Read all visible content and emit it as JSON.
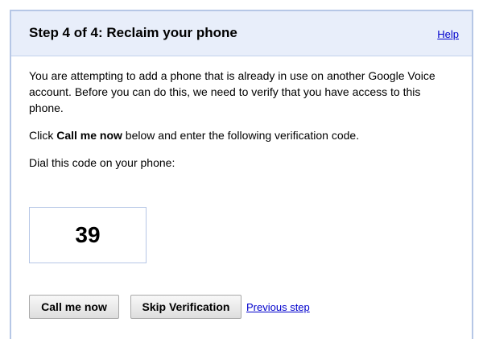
{
  "dialog": {
    "title": "Step 4 of 4: Reclaim your phone",
    "help_link": "Help"
  },
  "content": {
    "paragraph1": "You are attempting to add a phone that is already in use on another Google Voice account. Before you can do this, we need to verify that you have access to this phone.",
    "paragraph2_prefix": "Click ",
    "paragraph2_bold": "Call me now",
    "paragraph2_suffix": " below and enter the following verification code.",
    "dial_prompt": "Dial this code on your phone:",
    "verification_code": "39"
  },
  "actions": {
    "call_button": "Call me now",
    "skip_button": "Skip Verification",
    "previous_link": "Previous step"
  },
  "colors": {
    "header_bg": "#e8eefa",
    "border": "#b6c7e6",
    "link": "#0000cc"
  }
}
